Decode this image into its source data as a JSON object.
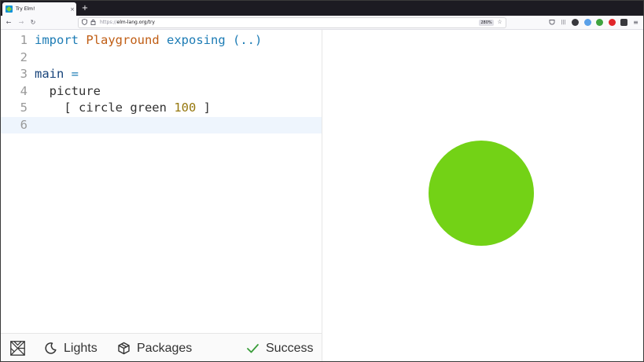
{
  "browser": {
    "tab_title": "Try Elm!",
    "tab_close": "×",
    "new_tab": "+",
    "url_scheme": "https://",
    "url_rest": "elm-lang.org/try",
    "zoom": "280%"
  },
  "editor": {
    "lines": [
      {
        "number": "1",
        "tokens": [
          {
            "text": "import",
            "cls": "kw"
          },
          {
            "text": " ",
            "cls": ""
          },
          {
            "text": "Playground",
            "cls": "mod"
          },
          {
            "text": " ",
            "cls": ""
          },
          {
            "text": "exposing",
            "cls": "kw"
          },
          {
            "text": " ",
            "cls": ""
          },
          {
            "text": "(..)",
            "cls": "kw"
          }
        ]
      },
      {
        "number": "2",
        "tokens": []
      },
      {
        "number": "3",
        "tokens": [
          {
            "text": "main",
            "cls": "ctor"
          },
          {
            "text": " ",
            "cls": ""
          },
          {
            "text": "=",
            "cls": "kw"
          }
        ]
      },
      {
        "number": "4",
        "tokens": [
          {
            "text": "  picture",
            "cls": ""
          }
        ]
      },
      {
        "number": "5",
        "tokens": [
          {
            "text": "    [ circle green ",
            "cls": ""
          },
          {
            "text": "100",
            "cls": "num"
          },
          {
            "text": " ]",
            "cls": ""
          }
        ]
      },
      {
        "number": "6",
        "tokens": []
      }
    ],
    "active_line": 6
  },
  "footer": {
    "lights_label": "Lights",
    "packages_label": "Packages",
    "status_label": "Success"
  },
  "output": {
    "shape": "circle",
    "color": "#73d216",
    "radius": 100
  },
  "colors": {
    "success": "#3a9d3a",
    "circle_green": "#73d216"
  }
}
